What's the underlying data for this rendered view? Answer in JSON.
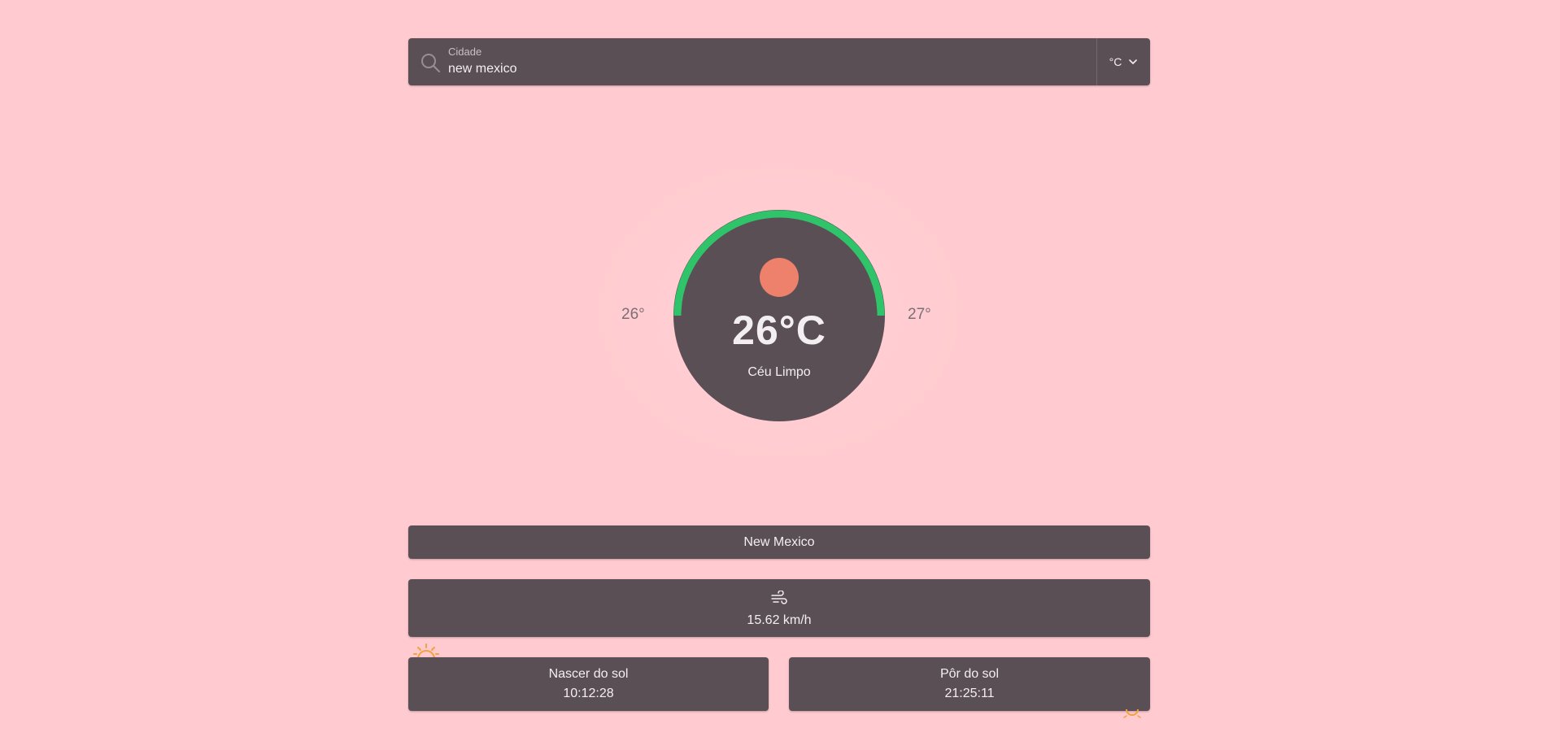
{
  "search": {
    "label": "Cidade",
    "value": "new mexico",
    "unit_selected": "°C"
  },
  "gauge": {
    "temperature": "26°C",
    "description": "Céu Limpo",
    "min": "26°",
    "max": "27°",
    "arc_color": "#2fc46a",
    "sun_color": "#ee816b"
  },
  "city": {
    "name": "New Mexico"
  },
  "wind": {
    "speed": "15.62 km/h"
  },
  "sunrise": {
    "title": "Nascer do sol",
    "time": "10:12:28"
  },
  "sunset": {
    "title": "Pôr do sol",
    "time": "21:25:11"
  },
  "colors": {
    "background": "#ffcbd0",
    "card": "#5b4f56",
    "text": "#f3eef0",
    "accent_sun": "#f2a23c"
  }
}
